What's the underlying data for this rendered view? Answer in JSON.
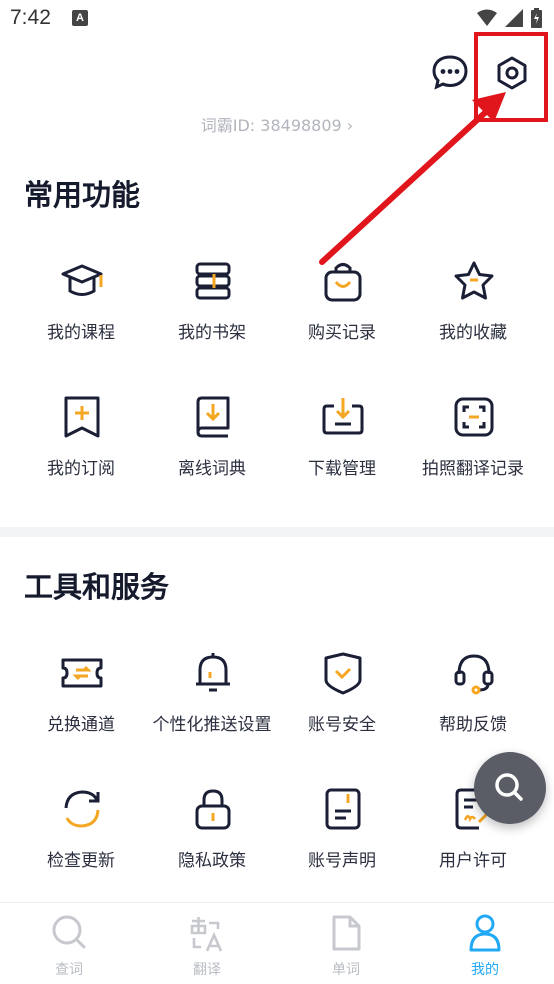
{
  "status_bar": {
    "time": "7:42",
    "notif_letter": "A"
  },
  "header": {
    "user_id": "词霸ID: 38498809 ›"
  },
  "common": {
    "title": "常用功能",
    "items": [
      {
        "label": "我的课程",
        "icon": "graduation-cap-icon"
      },
      {
        "label": "我的书架",
        "icon": "bookshelf-icon"
      },
      {
        "label": "购买记录",
        "icon": "shopping-bag-icon"
      },
      {
        "label": "我的收藏",
        "icon": "star-icon"
      },
      {
        "label": "我的订阅",
        "icon": "bookmark-plus-icon"
      },
      {
        "label": "离线词典",
        "icon": "download-book-icon"
      },
      {
        "label": "下载管理",
        "icon": "download-tray-icon"
      },
      {
        "label": "拍照翻译记录",
        "icon": "scan-frame-icon"
      }
    ]
  },
  "tools": {
    "title": "工具和服务",
    "items": [
      {
        "label": "兑换通道",
        "icon": "exchange-ticket-icon"
      },
      {
        "label": "个性化推送设置",
        "icon": "bell-icon"
      },
      {
        "label": "账号安全",
        "icon": "shield-check-icon"
      },
      {
        "label": "帮助反馈",
        "icon": "headset-icon"
      },
      {
        "label": "检查更新",
        "icon": "refresh-icon"
      },
      {
        "label": "隐私政策",
        "icon": "lock-icon"
      },
      {
        "label": "账号声明",
        "icon": "document-icon"
      },
      {
        "label": "用户许可",
        "icon": "license-icon"
      }
    ]
  },
  "tabs": [
    {
      "label": "查词",
      "icon": "search-icon",
      "active": false
    },
    {
      "label": "翻译",
      "icon": "translate-icon",
      "active": false
    },
    {
      "label": "单词",
      "icon": "word-card-icon",
      "active": false
    },
    {
      "label": "我的",
      "icon": "user-icon",
      "active": true
    }
  ],
  "colors": {
    "accent": "#21a9f5",
    "icon_stroke": "#1a1f36",
    "icon_highlight": "#f5a623",
    "annotation": "#e0161c"
  }
}
